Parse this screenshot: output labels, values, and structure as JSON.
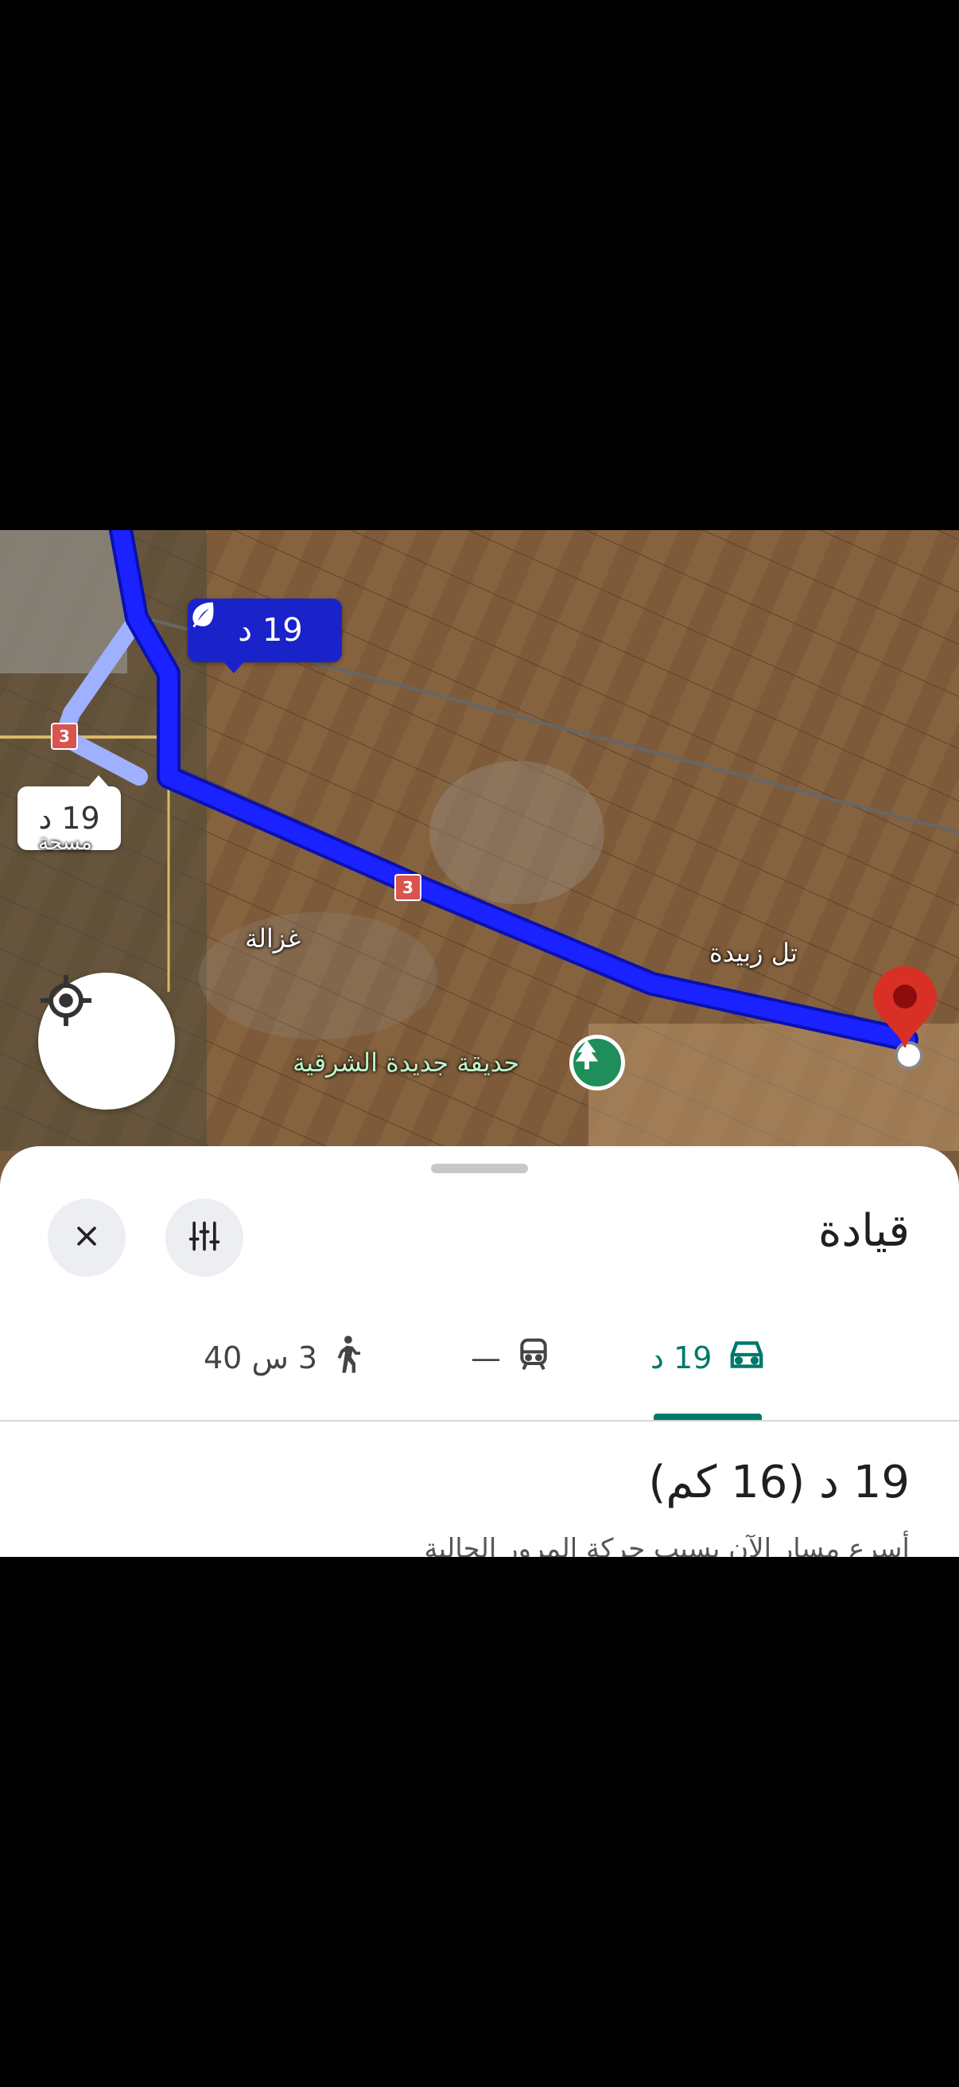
{
  "map": {
    "eco_route_chip": {
      "time": "19 د",
      "icon": "leaf-icon"
    },
    "alt_route_chip": {
      "time": "19 د"
    },
    "route_shield": "3",
    "places": {
      "ghazala": "غزالة",
      "tal_zubaida": "تل زبيدة",
      "park": "حديقة جديدة الشرقية",
      "partial_town": "مسحة"
    },
    "locate_button_icon": "my-location-icon",
    "destination_icon": "destination-pin-icon"
  },
  "sheet": {
    "title": "قيادة",
    "close_icon": "close-icon",
    "options_icon": "tune-icon",
    "modes": [
      {
        "id": "drive",
        "label": "19 د",
        "icon": "car-icon",
        "active": true
      },
      {
        "id": "transit",
        "label": "—",
        "icon": "train-icon",
        "active": false
      },
      {
        "id": "walk",
        "label": "3 س 40",
        "icon": "walk-icon",
        "active": false
      }
    ],
    "summary": "19 د (16 كم)",
    "note": "أسرع مسار الآن بسبب حركة المرور الحالية"
  },
  "colors": {
    "route_primary": "#1a22ff",
    "route_alt": "#9fb0ff",
    "accent": "#00796b",
    "destination": "#d93025"
  }
}
